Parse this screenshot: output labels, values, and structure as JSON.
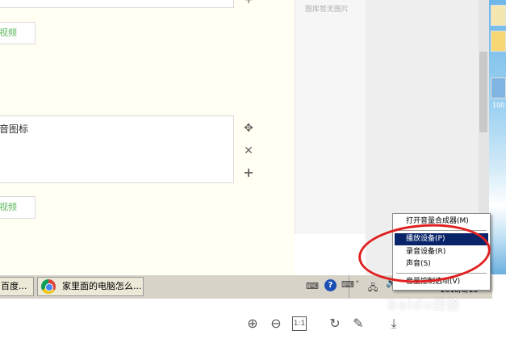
{
  "editor": {
    "video_button_top": "视频",
    "video_button_bottom": "视频",
    "textbox_text": "音图标"
  },
  "gallery": {
    "empty_text": "图库暂无图片"
  },
  "desktop": {
    "icon_label": "100"
  },
  "taskbar": {
    "task1_label": "百度...",
    "task2_label": "家里面的电脑怎么...",
    "tray_date": "2018/6/13"
  },
  "context_menu": {
    "items": [
      "打开音量合成器(M)",
      "播放设备(P)",
      "录音设备(R)",
      "声音(S)",
      "音量控制选项(V)"
    ],
    "selected_index": 1
  },
  "watermark": {
    "text": "Baidu经验"
  },
  "colors": {
    "editor_bg": "#fffff4",
    "menu_selected": "#0a246a",
    "annotation": "#e02020",
    "video_link": "#5cb85c"
  }
}
